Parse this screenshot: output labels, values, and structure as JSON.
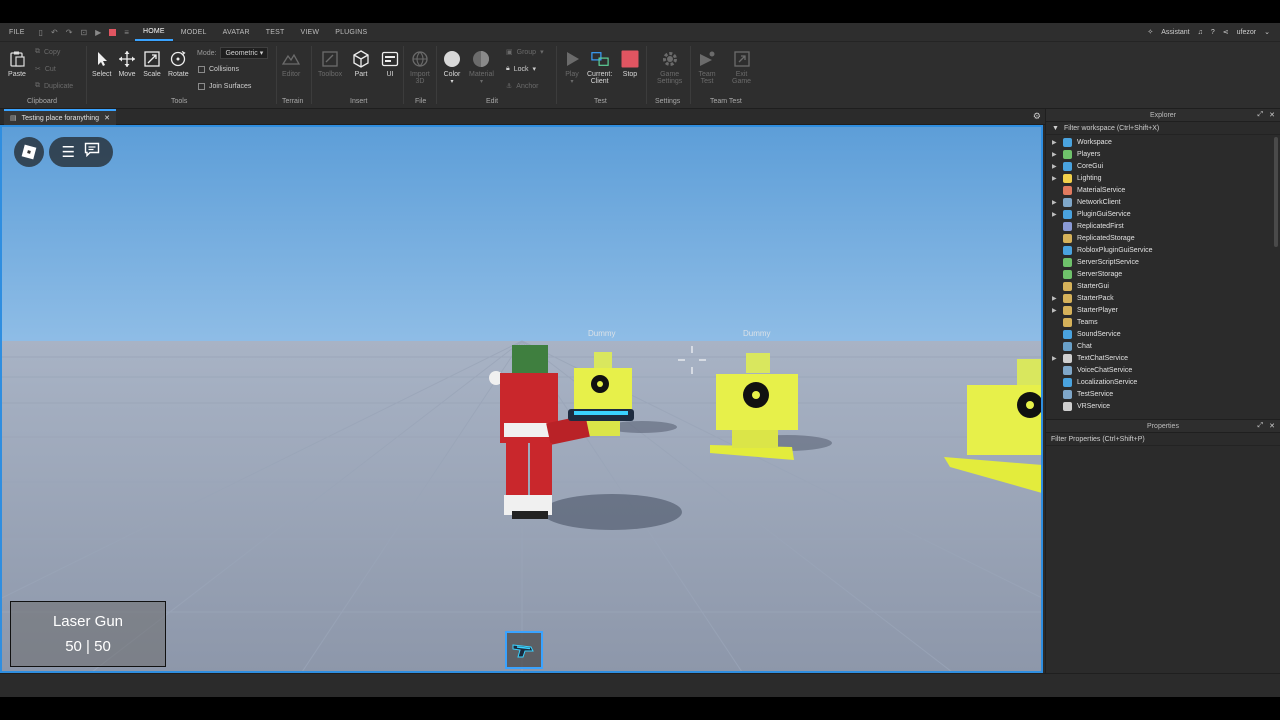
{
  "menubar": {
    "items": [
      "FILE",
      "HOME",
      "MODEL",
      "AVATAR",
      "TEST",
      "VIEW",
      "PLUGINS"
    ],
    "active": "HOME",
    "assistant": "Assistant",
    "user": "ufezor"
  },
  "ribbon": {
    "clipboard": {
      "paste": "Paste",
      "copy": "Copy",
      "cut": "Cut",
      "duplicate": "Duplicate",
      "label": "Clipboard"
    },
    "tools": {
      "select": "Select",
      "move": "Move",
      "scale": "Scale",
      "rotate": "Rotate",
      "mode_label": "Mode:",
      "mode_value": "Geometric",
      "collisions": "Collisions",
      "join_surfaces": "Join Surfaces",
      "label": "Tools"
    },
    "terrain": {
      "editor": "Editor",
      "label": "Terrain"
    },
    "insert": {
      "toolbox": "Toolbox",
      "part": "Part",
      "ui": "UI",
      "label": "Insert"
    },
    "file": {
      "import3d_1": "Import",
      "import3d_2": "3D",
      "label": "File"
    },
    "edit": {
      "color": "Color",
      "material": "Material",
      "group": "Group",
      "lock": "Lock",
      "anchor": "Anchor",
      "label": "Edit"
    },
    "test": {
      "play": "Play",
      "current_1": "Current:",
      "current_2": "Client",
      "stop": "Stop",
      "label": "Test"
    },
    "settings": {
      "game_1": "Game",
      "game_2": "Settings",
      "label": "Settings"
    },
    "team_test": {
      "team_1": "Team",
      "team_2": "Test",
      "exit_1": "Exit",
      "exit_2": "Game",
      "label": "Team Test"
    }
  },
  "tab": {
    "title": "Testing place foranything"
  },
  "viewport": {
    "hud_weapon": "Laser Gun",
    "hud_ammo": "50 | 50",
    "dummy_labels": [
      "Dummy",
      "Dummy"
    ]
  },
  "explorer": {
    "title": "Explorer",
    "filter": "Filter workspace (Ctrl+Shift+X)",
    "items": [
      {
        "label": "Workspace",
        "expand": true,
        "color": "#4aa3df"
      },
      {
        "label": "Players",
        "expand": true,
        "color": "#6fc26b"
      },
      {
        "label": "CoreGui",
        "expand": true,
        "color": "#4aa3df"
      },
      {
        "label": "Lighting",
        "expand": true,
        "color": "#f2d14b"
      },
      {
        "label": "MaterialService",
        "expand": false,
        "color": "#e07a5f"
      },
      {
        "label": "NetworkClient",
        "expand": true,
        "color": "#7fa7c9"
      },
      {
        "label": "PluginGuiService",
        "expand": true,
        "color": "#4aa3df"
      },
      {
        "label": "ReplicatedFirst",
        "expand": false,
        "color": "#8a9ad6"
      },
      {
        "label": "ReplicatedStorage",
        "expand": false,
        "color": "#d6b25a"
      },
      {
        "label": "RobloxPluginGuiService",
        "expand": false,
        "color": "#4aa3df"
      },
      {
        "label": "ServerScriptService",
        "expand": false,
        "color": "#6fc26b"
      },
      {
        "label": "ServerStorage",
        "expand": false,
        "color": "#6fc26b"
      },
      {
        "label": "StarterGui",
        "expand": false,
        "color": "#d6b25a"
      },
      {
        "label": "StarterPack",
        "expand": true,
        "color": "#d6b25a"
      },
      {
        "label": "StarterPlayer",
        "expand": true,
        "color": "#d6b25a"
      },
      {
        "label": "Teams",
        "expand": false,
        "color": "#d6b25a"
      },
      {
        "label": "SoundService",
        "expand": false,
        "color": "#4aa3df"
      },
      {
        "label": "Chat",
        "expand": false,
        "color": "#6aa0c8"
      },
      {
        "label": "TextChatService",
        "expand": true,
        "color": "#cfcfcf"
      },
      {
        "label": "VoiceChatService",
        "expand": false,
        "color": "#7fa7c9"
      },
      {
        "label": "LocalizationService",
        "expand": false,
        "color": "#4aa3df"
      },
      {
        "label": "TestService",
        "expand": false,
        "color": "#7fa7c9"
      },
      {
        "label": "VRService",
        "expand": false,
        "color": "#cfcfcf"
      }
    ]
  },
  "properties": {
    "title": "Properties",
    "filter": "Filter Properties (Ctrl+Shift+P)"
  },
  "colors": {
    "accent": "#3aa3ff",
    "stop": "#e05561"
  }
}
